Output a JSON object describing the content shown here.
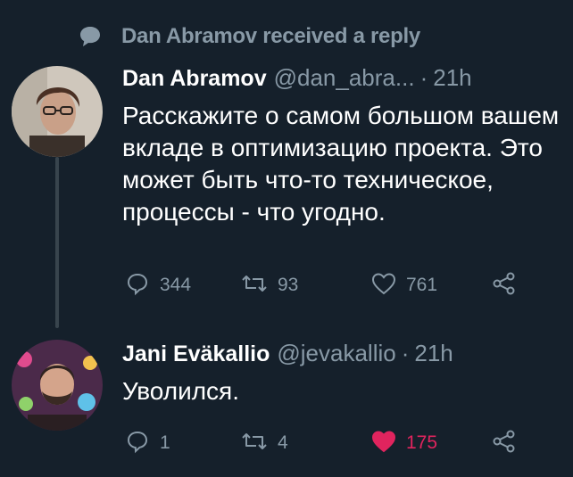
{
  "context": {
    "text": "Dan Abramov received a reply",
    "icon": "speech-bubble-icon"
  },
  "tweets": [
    {
      "name": "Dan Abramov",
      "handle": "@dan_abra...",
      "separator": "·",
      "time": "21h",
      "body": "Расскажите о самом большом вашем вкладе в оптимизацию проекта. Это может быть что-то техническое, процессы - что угодно.",
      "actions": {
        "replies": "344",
        "retweets": "93",
        "likes": "761",
        "liked": false
      }
    },
    {
      "name": "Jani Eväkallio",
      "handle": "@jevakallio",
      "separator": "·",
      "time": "21h",
      "body": "Уволился.",
      "actions": {
        "replies": "1",
        "retweets": "4",
        "likes": "175",
        "liked": true
      }
    }
  ],
  "colors": {
    "background": "#15202b",
    "muted": "#8899a6",
    "like": "#e0245e",
    "thread_line": "#38444d"
  }
}
